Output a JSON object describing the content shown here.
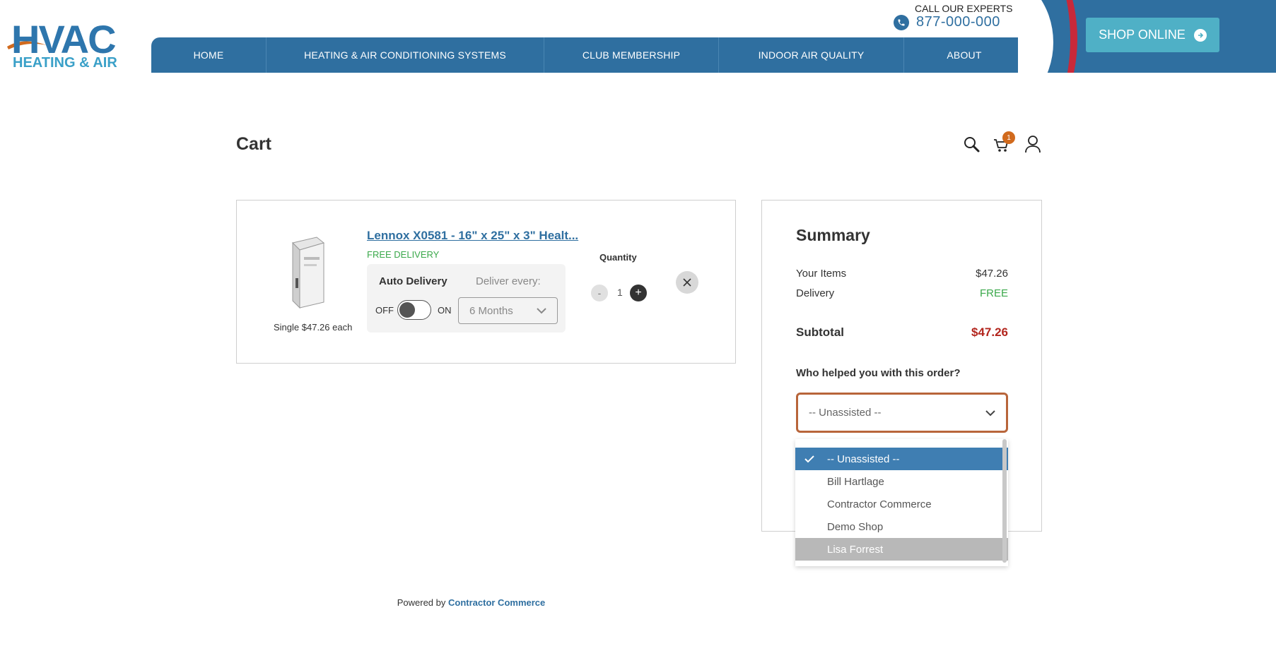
{
  "logo": {
    "main": "HVAC",
    "sub": "HEATING & AIR"
  },
  "nav": {
    "items": [
      {
        "label": "HOME",
        "width": 163
      },
      {
        "label": "HEATING & AIR CONDITIONING SYSTEMS",
        "width": 393
      },
      {
        "label": "CLUB MEMBERSHIP",
        "width": 247
      },
      {
        "label": "INDOOR AIR QUALITY",
        "width": 262
      },
      {
        "label": "ABOUT",
        "width": 170
      }
    ]
  },
  "call": {
    "label": "CALL OUR EXPERTS",
    "phone": "877-000-000"
  },
  "shop": {
    "label": "SHOP ONLINE"
  },
  "cart": {
    "title": "Cart",
    "badge_count": "1"
  },
  "item": {
    "name": "Lennox X0581 - 16\" x 25\" x 3\" Healt...",
    "delivery": "FREE DELIVERY",
    "single_price": "Single $47.26 each",
    "auto_delivery_label": "Auto Delivery",
    "deliver_every_label": "Deliver every:",
    "toggle_off": "OFF",
    "toggle_on": "ON",
    "interval": "6 Months",
    "quantity_label": "Quantity",
    "quantity": "1",
    "minus": "-",
    "plus": "+"
  },
  "summary": {
    "title": "Summary",
    "items_label": "Your Items",
    "items_value": "$47.26",
    "delivery_label": "Delivery",
    "delivery_value": "FREE",
    "subtotal_label": "Subtotal",
    "subtotal_value": "$47.26",
    "helped_label": "Who helped you with this order?",
    "helped_value": "-- Unassisted --"
  },
  "dropdown": {
    "options": [
      "-- Unassisted --",
      "Bill Hartlage",
      "Contractor Commerce",
      "Demo Shop",
      "Lisa Forrest"
    ]
  },
  "footer": {
    "prefix": "Powered by",
    "brand": "Contractor Commerce"
  },
  "colors": {
    "brand_blue": "#2f6fa0",
    "accent_red": "#c8293a",
    "shop_btn": "#4fb0c6",
    "free_green": "#3aa84a",
    "price_red": "#b3261e"
  }
}
